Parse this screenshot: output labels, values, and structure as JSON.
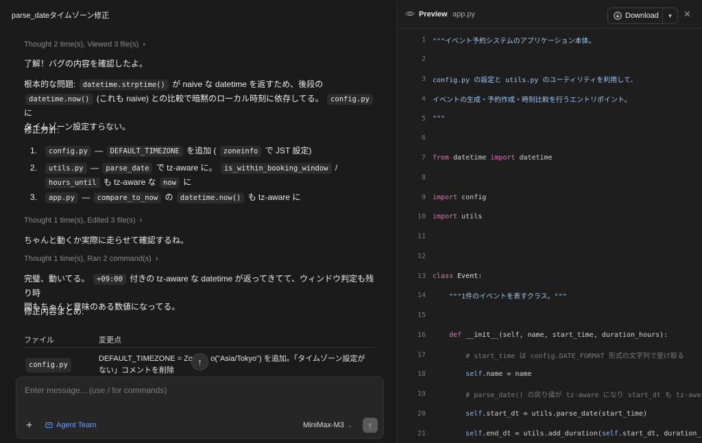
{
  "left": {
    "title": "parse_dateタイムゾーン修正",
    "thought1": "Thought 2 time(s), Viewed 3 file(s)",
    "p1": "了解！バグの内容を確認したよ。",
    "p2": {
      "a": "根本的な問題:",
      "code1": "datetime.strptime()",
      "b": "が naive な datetime を返すため、後段の",
      "code2": "datetime.now()",
      "c": "(これも naive) との比較で暗黙のローカル時刻に依存してる。",
      "code3": "config.py",
      "d": "に",
      "e": "タイムゾーン設定すらない。"
    },
    "p3": "修正方針:",
    "list": [
      {
        "num": "1.",
        "code1": "config.py",
        "t1": "—",
        "code2": "DEFAULT_TIMEZONE",
        "t2": "を追加 (",
        "code3": "zoneinfo",
        "t3": "で JST 設定)"
      },
      {
        "num": "2.",
        "code1": "utils.py",
        "t1": "—",
        "code2": "parse_date",
        "t2": "で tz-aware に。",
        "code3": "is_within_booking_window",
        "t3": "/",
        "code4": "hours_until",
        "t4": "も tz-aware な",
        "code5": "now",
        "t5": "に"
      },
      {
        "num": "3.",
        "code1": "app.py",
        "t1": "—",
        "code2": "compare_to_now",
        "t2": "の",
        "code3": "datetime.now()",
        "t3": "も tz-aware に"
      }
    ],
    "thought2": "Thought 1 time(s), Edited 3 file(s)",
    "p4": "ちゃんと動くか実際に走らせて確認するね。",
    "thought3": "Thought 1 time(s), Ran 2 command(s)",
    "p5": {
      "a": "完璧、動いてる。",
      "code1": "+09:00",
      "b": "付きの tz-aware な datetime が返ってきてて、ウィンドウ判定も残り時",
      "c": "間もちゃんと意味のある数値になってる。"
    },
    "p6": "修正内容まとめ:",
    "table": {
      "headers": [
        "ファイル",
        "変更点"
      ],
      "rows": [
        {
          "file": "config.py",
          "change_a": "DEFAULT_TIMEZONE = Zone",
          "change_b": "o(\"Asia/Tokyo\") を追加。「タイムゾーン設定が",
          "change_c": "ない」コメントを削除"
        }
      ]
    }
  },
  "input": {
    "placeholder": "Enter message... (use / for commands)",
    "agent_team": "Agent Team",
    "model": "MiniMax-M3"
  },
  "right": {
    "preview": "Preview",
    "file": "app.py",
    "download": "Download"
  },
  "code_lines": [
    {
      "n": "1",
      "parts": [
        [
          "s",
          "\"\"\"イベント予約システムのアプリケーション本体。"
        ]
      ]
    },
    {
      "n": "2",
      "parts": []
    },
    {
      "n": "3",
      "parts": [
        [
          "s",
          "config.py の設定と utils.py のユーティリティを利用して、"
        ]
      ]
    },
    {
      "n": "4",
      "parts": [
        [
          "s",
          "イベントの生成・予約作成・時刻比較を行うエントリポイント。"
        ]
      ]
    },
    {
      "n": "5",
      "parts": [
        [
          "s",
          "\"\"\""
        ]
      ]
    },
    {
      "n": "6",
      "parts": []
    },
    {
      "n": "7",
      "parts": [
        [
          "k",
          "from"
        ],
        [
          "p",
          " datetime "
        ],
        [
          "k",
          "import"
        ],
        [
          "p",
          " datetime"
        ]
      ]
    },
    {
      "n": "8",
      "parts": []
    },
    {
      "n": "9",
      "parts": [
        [
          "k",
          "import"
        ],
        [
          "p",
          " config"
        ]
      ]
    },
    {
      "n": "10",
      "parts": [
        [
          "k",
          "import"
        ],
        [
          "p",
          " utils"
        ]
      ]
    },
    {
      "n": "11",
      "parts": []
    },
    {
      "n": "12",
      "parts": []
    },
    {
      "n": "13",
      "parts": [
        [
          "k",
          "class"
        ],
        [
          "p",
          " "
        ],
        [
          "fn",
          "Event"
        ],
        [
          "p",
          ":"
        ]
      ]
    },
    {
      "n": "14",
      "parts": [
        [
          "p",
          "    "
        ],
        [
          "s",
          "\"\"\"1件のイベントを表すクラス。\"\"\""
        ]
      ]
    },
    {
      "n": "15",
      "parts": []
    },
    {
      "n": "16",
      "parts": [
        [
          "p",
          "    "
        ],
        [
          "k",
          "def"
        ],
        [
          "p",
          " "
        ],
        [
          "fn",
          "__init__"
        ],
        [
          "p",
          "(self, name, start_time, duration_hours):"
        ]
      ]
    },
    {
      "n": "17",
      "parts": [
        [
          "p",
          "        "
        ],
        [
          "c",
          "# start_time は config.DATE_FORMAT 形式の文字列で受け取る"
        ]
      ]
    },
    {
      "n": "18",
      "parts": [
        [
          "p",
          "        "
        ],
        [
          "self",
          "self"
        ],
        [
          "p",
          ".name = name"
        ]
      ]
    },
    {
      "n": "19",
      "parts": [
        [
          "p",
          "        "
        ],
        [
          "c",
          "# parse_date() の戻り値が tz-aware になり start_dt も tz-aware"
        ]
      ]
    },
    {
      "n": "20",
      "parts": [
        [
          "p",
          "        "
        ],
        [
          "self",
          "self"
        ],
        [
          "p",
          ".start_dt = utils.parse_date(start_time)"
        ]
      ]
    },
    {
      "n": "21",
      "parts": [
        [
          "p",
          "        "
        ],
        [
          "self",
          "self"
        ],
        [
          "p",
          ".end_dt = utils.add_duration("
        ],
        [
          "self",
          "self"
        ],
        [
          "p",
          ".start_dt, duration_"
        ]
      ]
    }
  ]
}
